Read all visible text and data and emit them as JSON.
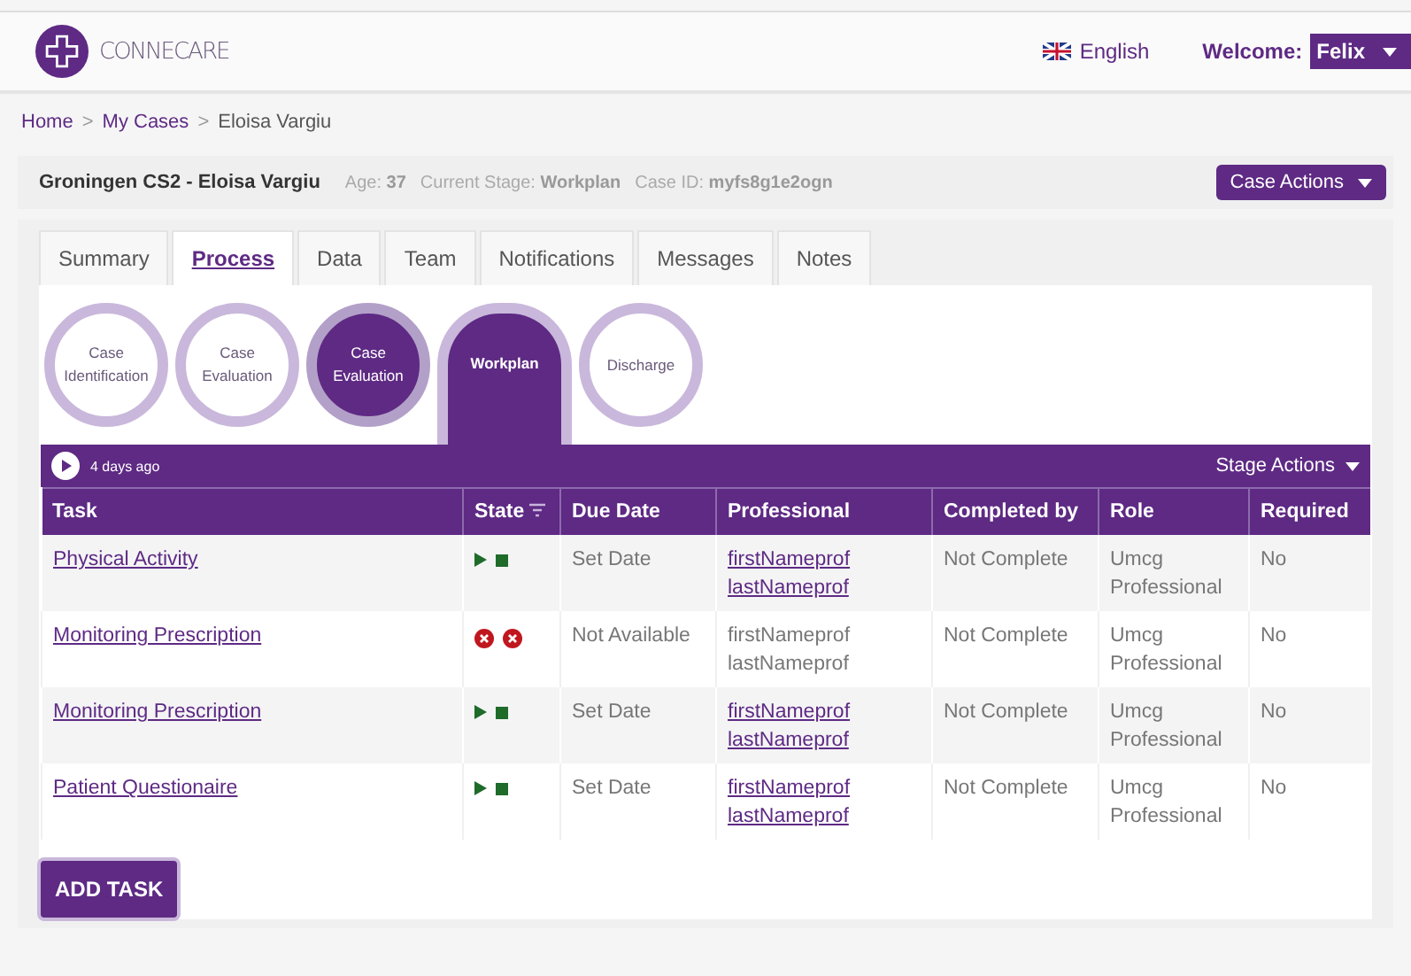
{
  "header": {
    "logo_text": "CONNECARE",
    "language": "English",
    "welcome_label": "Welcome:",
    "user": "Felix"
  },
  "breadcrumb": [
    {
      "label": "Home",
      "current": false
    },
    {
      "label": "My Cases",
      "current": false
    },
    {
      "label": "Eloisa Vargiu",
      "current": true
    }
  ],
  "breadcrumb_separator": ">",
  "case": {
    "title": "Groningen CS2 - Eloisa Vargiu",
    "fields": [
      {
        "label": "Age:",
        "value": "37"
      },
      {
        "label": "Current Stage:",
        "value": "Workplan"
      },
      {
        "label": "Case ID:",
        "value": "myfs8g1e2ogn"
      }
    ],
    "actions": "Case Actions"
  },
  "tabs": [
    {
      "label": "Summary",
      "selected": false
    },
    {
      "label": "Process",
      "selected": true
    },
    {
      "label": "Data",
      "selected": false
    },
    {
      "label": "Team",
      "selected": false
    },
    {
      "label": "Notifications",
      "selected": false
    },
    {
      "label": "Messages",
      "selected": false
    },
    {
      "label": "Notes",
      "selected": false
    }
  ],
  "stages": [
    {
      "label": "Case Identification",
      "kind": "done"
    },
    {
      "label": "Case Evaluation",
      "kind": "done"
    },
    {
      "label": "Case Evaluation",
      "kind": "current"
    },
    {
      "label": "Workplan",
      "kind": "active"
    },
    {
      "label": "Discharge",
      "kind": "pending"
    }
  ],
  "stage_bar": {
    "time": "4 days ago",
    "actions": "Stage Actions"
  },
  "table": {
    "columns": [
      "Task",
      "State",
      "Due Date",
      "Professional",
      "Completed by",
      "Role",
      "Required"
    ],
    "rows": [
      {
        "task": "Physical Activity",
        "kind": "running",
        "due_date": "Set Date",
        "professional": [
          "firstNameprof",
          "lastNameprof"
        ],
        "professional_linked": true,
        "completed_by": "Not Complete",
        "role": "Umcg Professional",
        "required": "No"
      },
      {
        "task": "Monitoring Prescription",
        "kind": "unavailable",
        "due_date": "Not Available",
        "professional": [
          "firstNameprof",
          "lastNameprof"
        ],
        "professional_linked": false,
        "completed_by": "Not Complete",
        "role": "Umcg Professional",
        "required": "No"
      },
      {
        "task": "Monitoring Prescription",
        "kind": "running",
        "due_date": "Set Date",
        "professional": [
          "firstNameprof",
          "lastNameprof"
        ],
        "professional_linked": true,
        "completed_by": "Not Complete",
        "role": "Umcg Professional",
        "required": "No"
      },
      {
        "task": "Patient Questionaire",
        "kind": "running",
        "due_date": "Set Date",
        "professional": [
          "firstNameprof",
          "lastNameprof"
        ],
        "professional_linked": true,
        "completed_by": "Not Complete",
        "role": "Umcg Professional",
        "required": "No"
      }
    ]
  },
  "add_task": "ADD TASK"
}
